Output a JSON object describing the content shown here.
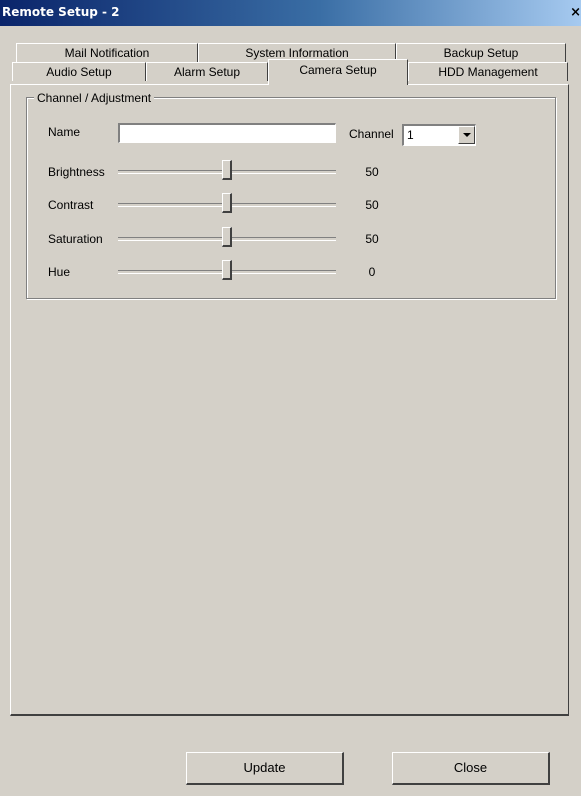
{
  "window": {
    "title": "Remote Setup - 2",
    "close_glyph": "×"
  },
  "tabs_row1": [
    {
      "label": "Mail Notification"
    },
    {
      "label": "System Information"
    },
    {
      "label": "Backup Setup"
    }
  ],
  "tabs_row2": [
    {
      "label": "Audio Setup"
    },
    {
      "label": "Alarm Setup"
    },
    {
      "label": "Camera Setup",
      "active": true
    },
    {
      "label": "HDD Management"
    }
  ],
  "group": {
    "title": "Channel / Adjustment",
    "name_label": "Name",
    "name_value": "",
    "channel_label": "Channel",
    "channel_value": "1",
    "sliders": [
      {
        "label": "Brightness",
        "value": "50",
        "fraction": 0.5
      },
      {
        "label": "Contrast",
        "value": "50",
        "fraction": 0.5
      },
      {
        "label": "Saturation",
        "value": "50",
        "fraction": 0.5
      },
      {
        "label": "Hue",
        "value": "0",
        "fraction": 0.5
      }
    ]
  },
  "buttons": {
    "update": "Update",
    "close": "Close"
  }
}
